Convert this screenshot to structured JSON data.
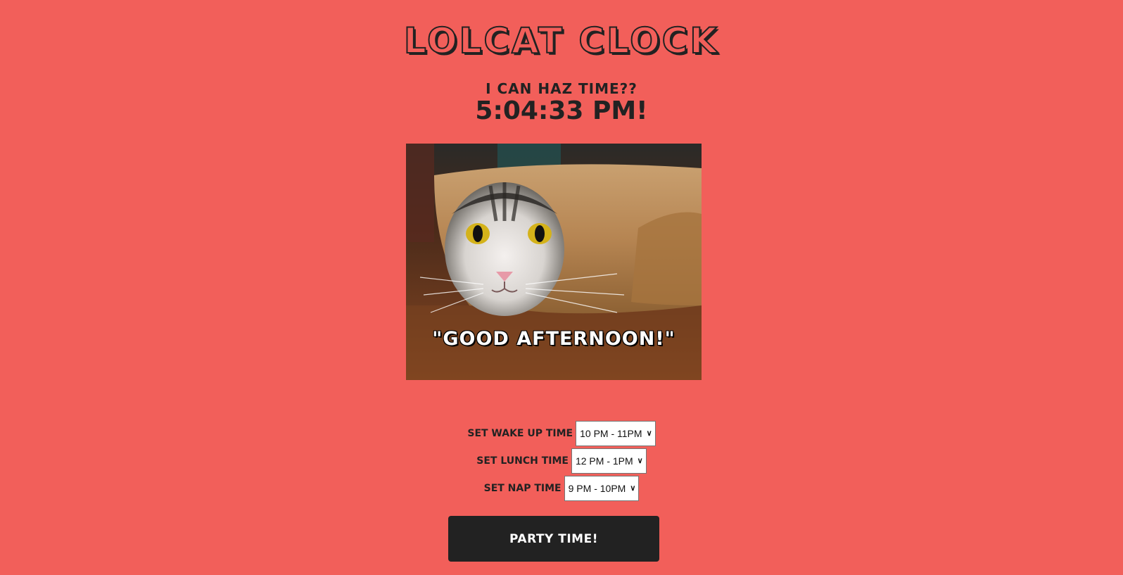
{
  "header": {
    "title": "LOLCAT CLOCK",
    "subtitle": "I CAN HAZ TIME??",
    "time": "5:04:33 PM!"
  },
  "image": {
    "caption": "\"GOOD AFTERNOON!\"",
    "subject": "cat wrapped in brown paper"
  },
  "controls": {
    "wake": {
      "label": "SET WAKE UP TIME",
      "value": "10 PM - 11PM"
    },
    "lunch": {
      "label": "SET LUNCH TIME",
      "value": "12 PM - 1PM"
    },
    "nap": {
      "label": "SET NAP TIME",
      "value": "9 PM - 10PM"
    }
  },
  "party_button": {
    "label": "PARTY TIME!"
  },
  "colors": {
    "background": "#f25f5a",
    "text": "#222222",
    "button": "#222222"
  }
}
